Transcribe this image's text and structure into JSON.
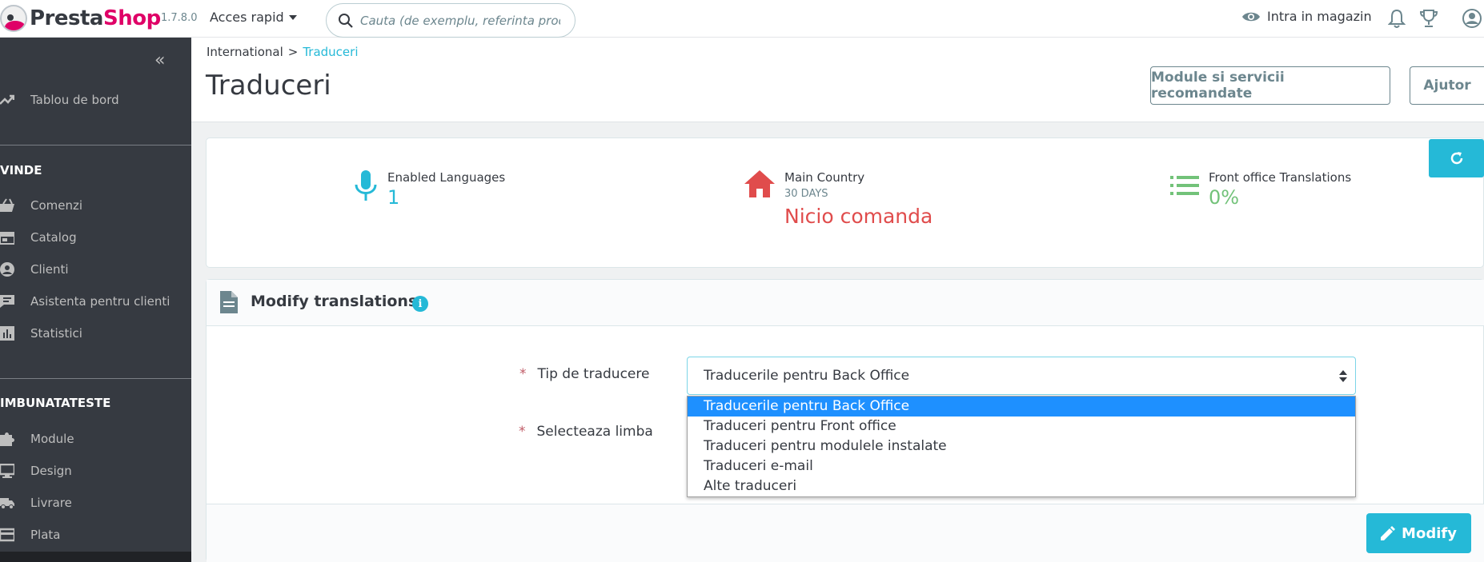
{
  "header": {
    "logo_pre": "Presta",
    "logo_post": "Shop",
    "version": "1.7.8.0",
    "quick_access": "Acces rapid",
    "search_placeholder": "Cauta (de exemplu, referinta produsul",
    "view_shop": "Intra in magazin"
  },
  "sidebar": {
    "collapse": "«",
    "dashboard": "Tablou de bord",
    "section_sell": "VINDE",
    "sell_items": [
      "Comenzi",
      "Catalog",
      "Clienti",
      "Asistenta pentru clienti",
      "Statistici"
    ],
    "section_improve": "IMBUNATATESTE",
    "improve_items": [
      "Module",
      "Design",
      "Livrare",
      "Plata"
    ]
  },
  "page": {
    "breadcrumb_parent": "International",
    "breadcrumb_sep": ">",
    "breadcrumb_current": "Traduceri",
    "title": "Traduceri",
    "btn_recommended": "Module si servicii recomandate",
    "btn_help": "Ajutor"
  },
  "kpi": {
    "languages_title": "Enabled Languages",
    "languages_value": "1",
    "country_title": "Main Country",
    "country_sub": "30 DAYS",
    "country_value": "Nicio comanda",
    "front_title": "Front office Translations",
    "front_value": "0%"
  },
  "panel": {
    "title": "Modify translations",
    "info": "i",
    "label_type": "Tip de traducere",
    "label_lang": "Selecteaza limba",
    "required": "*",
    "selected_type": "Traducerile pentru Back Office",
    "options": [
      "Traducerile pentru Back Office",
      "Traduceri pentru Front office",
      "Traduceri pentru modulele instalate",
      "Traduceri e-mail",
      "Alte traduceri"
    ],
    "modify_button": "Modify"
  },
  "colors": {
    "accent": "#25b9d7",
    "sidebar_bg": "#363a41",
    "danger": "#e04c4c",
    "success": "#72c279",
    "selected_option": "#1e90ff"
  }
}
